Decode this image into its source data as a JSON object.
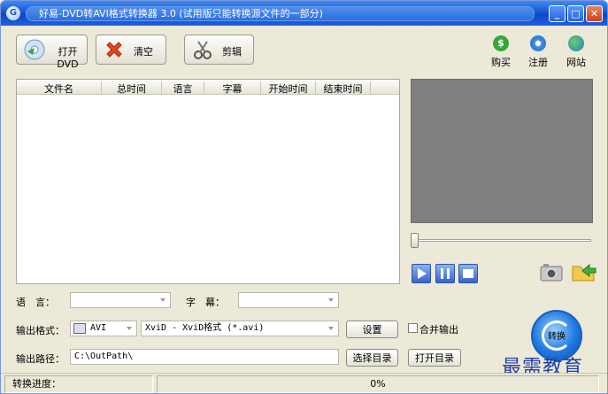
{
  "title": "好易-DVD转AVI格式转换器 3.0 (试用版只能转换源文件的一部分)",
  "toolbar": {
    "open_dvd": "打开DVD",
    "clear": "清空",
    "cut": "剪辑",
    "buy": "购买",
    "register": "注册",
    "website": "网站"
  },
  "list": {
    "columns": [
      "文件名",
      "总时间",
      "语言",
      "字幕",
      "开始时间",
      "结束时间"
    ]
  },
  "form": {
    "language_label": "语　言：",
    "language_value": "",
    "subtitle_label": "字　幕：",
    "subtitle_value": "",
    "format_label": "输出格式：",
    "format_value": "AVI",
    "codec_value": "XviD - XviD格式 (*.avi)",
    "settings_button": "设置",
    "merge_label": "合并输出",
    "path_label": "输出路径：",
    "path_value": "C:\\OutPath\\",
    "choose_dir_button": "选择目录",
    "open_dir_button": "打开目录"
  },
  "convert_button": "转换",
  "status": {
    "progress_label": "转换进度：",
    "progress_value": "0%"
  },
  "watermark": "最需教育",
  "colors": {
    "titlebar": "#1458d8",
    "preview": "#7f7f7f",
    "window_bg": "#ece9d8"
  }
}
